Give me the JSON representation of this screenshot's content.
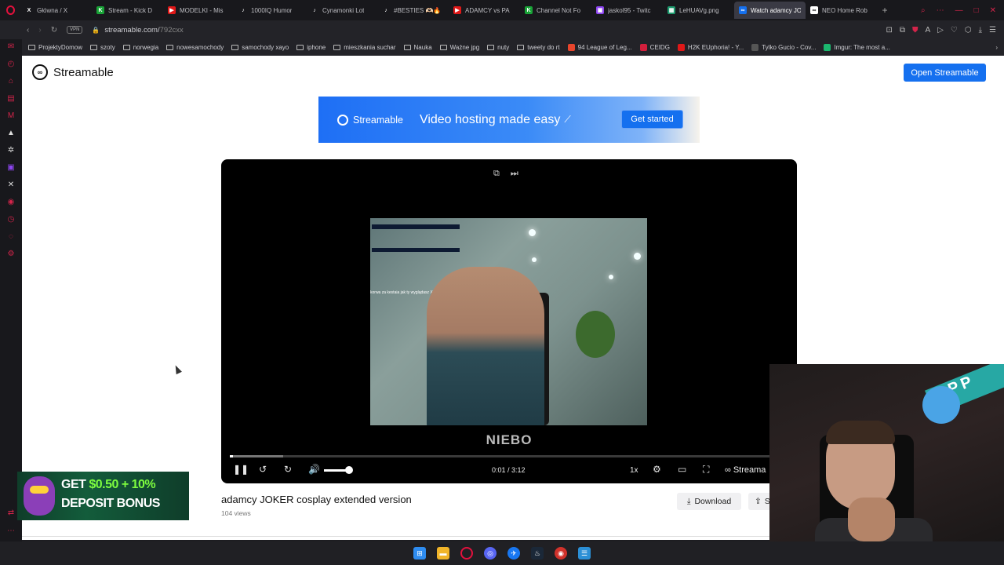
{
  "tabs": [
    {
      "label": "Główna / X",
      "fav": "X",
      "color": "#18181c"
    },
    {
      "label": "Stream - Kick D",
      "fav": "K",
      "color": "#19a337"
    },
    {
      "label": "MODELKI - Mis",
      "fav": "▶",
      "color": "#e01818"
    },
    {
      "label": "1000IQ Humor",
      "fav": "♪",
      "color": "#18181c"
    },
    {
      "label": "Cynamonki Lot",
      "fav": "♪",
      "color": "#18181c"
    },
    {
      "label": "#BESTIES 🫶🏻🔥",
      "fav": "♪",
      "color": "#18181c"
    },
    {
      "label": "ADAMCY vs PA",
      "fav": "▶",
      "color": "#e01818"
    },
    {
      "label": "Channel Not Fo",
      "fav": "K",
      "color": "#19a337"
    },
    {
      "label": "jaskol95 - Twitc",
      "fav": "▣",
      "color": "#8d45f0"
    },
    {
      "label": "LeHUAVg.png",
      "fav": "▦",
      "color": "#1d9a6e"
    },
    {
      "label": "Watch adamcy JOKER",
      "fav": "∞",
      "color": "#1570ef",
      "active": true
    },
    {
      "label": "NEO Home Rob",
      "fav": "∞",
      "color": "#ffffff"
    }
  ],
  "address": {
    "vpn": "VPN",
    "host": "streamable.com/",
    "path": "792cxx"
  },
  "bookmarks": [
    {
      "label": "ProjektyDomow",
      "type": "folder"
    },
    {
      "label": "szoty",
      "type": "folder"
    },
    {
      "label": "norwegia",
      "type": "folder"
    },
    {
      "label": "nowesamochody",
      "type": "folder"
    },
    {
      "label": "samochody xayo",
      "type": "folder"
    },
    {
      "label": "iphone",
      "type": "folder"
    },
    {
      "label": "mieszkania suchar",
      "type": "folder"
    },
    {
      "label": "Nauka",
      "type": "folder"
    },
    {
      "label": "Ważne jpg",
      "type": "folder"
    },
    {
      "label": "nuty",
      "type": "folder"
    },
    {
      "label": "tweety do rt",
      "type": "folder"
    },
    {
      "label": "94 League of Leg...",
      "type": "site",
      "color": "#e8452c"
    },
    {
      "label": "CEIDG",
      "type": "site",
      "color": "#d21f3c"
    },
    {
      "label": "H2K EUphoria! - Y...",
      "type": "site",
      "color": "#e01818"
    },
    {
      "label": "Tylko Gucio - Cov...",
      "type": "site",
      "color": "#555555"
    },
    {
      "label": "Imgur: The most a...",
      "type": "site",
      "color": "#1bb76e"
    }
  ],
  "page": {
    "logo": "Streamable",
    "open_button": "Open Streamable",
    "banner": {
      "brand": "Streamable",
      "tagline": "Video hosting made easy",
      "cta": "Get started"
    },
    "video": {
      "watermark": "NIEBO",
      "chat_text": "korwa za kestaia jak ty wyglądasz XD",
      "current_time": "0:01",
      "duration": "3:12",
      "time_display": "0:01 / 3:12",
      "speed": "1x",
      "brand": "Streama",
      "progress_fraction": 0.005,
      "buffered_fraction": 0.095,
      "volume_fraction": 0.8
    },
    "title": "adamcy JOKER cosplay extended version",
    "views": "104 views",
    "download": "Download",
    "share": "S"
  },
  "ad": {
    "line1_pre": "GET ",
    "line1_hl": "$0.50 + 10%",
    "line2": "DEPOSIT BONUS"
  },
  "webcam": {
    "banner": "APP"
  },
  "colors": {
    "accent": "#1570ef",
    "browser_red": "#e3113d"
  }
}
